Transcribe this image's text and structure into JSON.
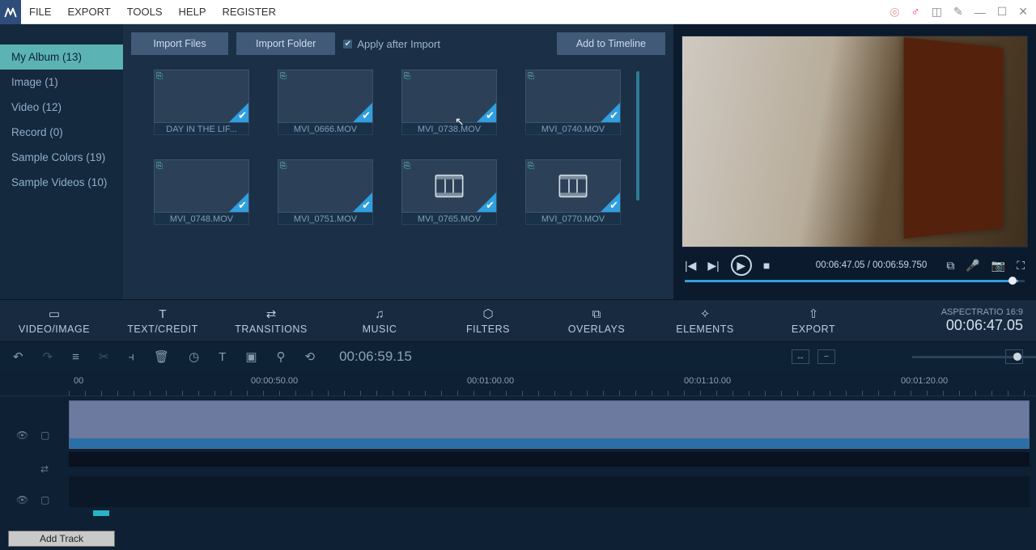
{
  "menu": {
    "items": [
      "FILE",
      "EXPORT",
      "TOOLS",
      "HELP",
      "REGISTER"
    ]
  },
  "sidebar": {
    "items": [
      {
        "label": "My Album (13)",
        "active": true
      },
      {
        "label": "Image (1)"
      },
      {
        "label": "Video (12)"
      },
      {
        "label": "Record (0)"
      },
      {
        "label": "Sample Colors (19)"
      },
      {
        "label": "Sample Videos (10)"
      }
    ]
  },
  "media_toolbar": {
    "import_files": "Import Files",
    "import_folder": "Import Folder",
    "apply_after_import": "Apply after Import",
    "add_to_timeline": "Add to Timeline"
  },
  "thumbs": [
    {
      "label": "DAY IN THE LIF...",
      "kind": "img",
      "cls": "bg1"
    },
    {
      "label": "MVI_0666.MOV",
      "kind": "img",
      "cls": "bg2"
    },
    {
      "label": "MVI_0738.MOV",
      "kind": "img",
      "cls": "bg3"
    },
    {
      "label": "MVI_0740.MOV",
      "kind": "img",
      "cls": "bg4"
    },
    {
      "label": "MVI_0748.MOV",
      "kind": "img",
      "cls": "bg5"
    },
    {
      "label": "MVI_0751.MOV",
      "kind": "img",
      "cls": "bg6"
    },
    {
      "label": "MVI_0765.MOV",
      "kind": "film"
    },
    {
      "label": "MVI_0770.MOV",
      "kind": "film"
    }
  ],
  "preview": {
    "current": "00:06:47.05",
    "total": "00:06:59.750"
  },
  "tabs": [
    {
      "icon": "▭",
      "label": "VIDEO/IMAGE"
    },
    {
      "icon": "T",
      "label": "TEXT/CREDIT"
    },
    {
      "icon": "⇄",
      "label": "TRANSITIONS"
    },
    {
      "icon": "♫",
      "label": "MUSIC"
    },
    {
      "icon": "⬡",
      "label": "FILTERS"
    },
    {
      "icon": "⧉",
      "label": "OVERLAYS"
    },
    {
      "icon": "✧",
      "label": "ELEMENTS"
    },
    {
      "icon": "⇧",
      "label": "EXPORT"
    }
  ],
  "mod_right": {
    "aspect": "ASPECTRATIO 16:9",
    "timecode": "00:06:47.05"
  },
  "edit_tb": {
    "timecode": "00:06:59.15"
  },
  "ruler": [
    "00",
    "00:00:50.00",
    "00:01:00.00",
    "00:01:10.00",
    "00:01:20.00"
  ],
  "add_track": "Add Track"
}
